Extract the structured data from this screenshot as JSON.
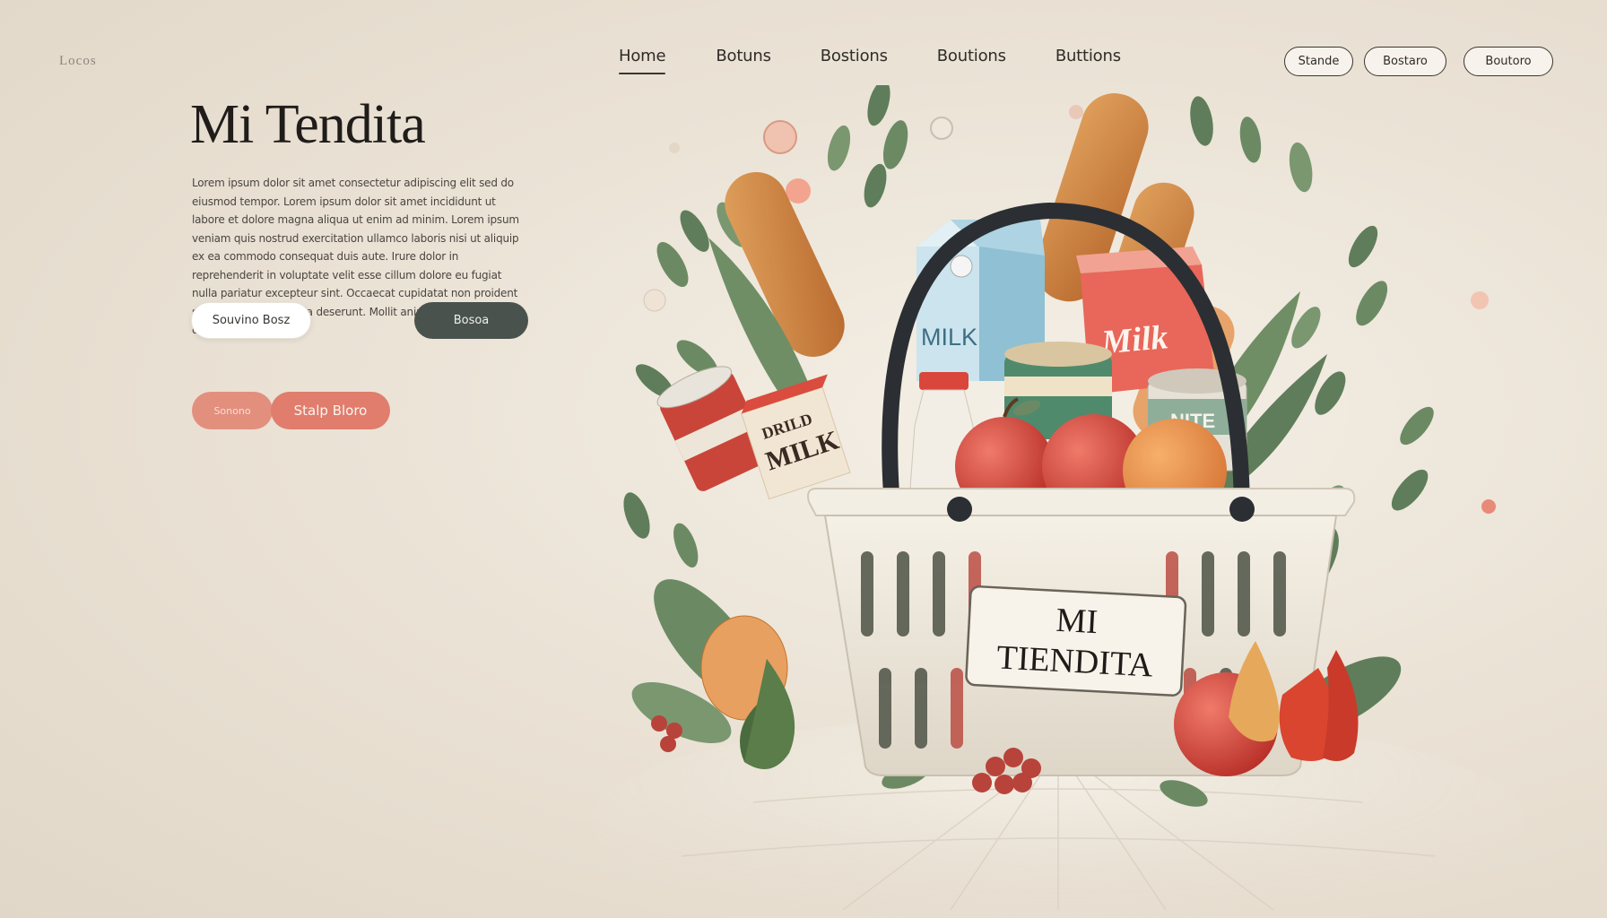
{
  "brand": {
    "logo_text": "Locos",
    "title": "Mi Tendita"
  },
  "nav": {
    "items": [
      {
        "label": "Home",
        "active": true
      },
      {
        "label": "Botuns"
      },
      {
        "label": "Bostions"
      },
      {
        "label": "Boutions"
      },
      {
        "label": "Buttions"
      }
    ]
  },
  "header_buttons": [
    "Stande",
    "Bostaro",
    "Boutoro"
  ],
  "hero": {
    "description": "Lorem ipsum dolor sit amet consectetur adipiscing elit sed do eiusmod tempor. Lorem ipsum dolor sit amet incididunt ut labore et dolore magna aliqua ut enim ad minim. Lorem ipsum veniam quis nostrud exercitation ullamco laboris nisi ut aliquip ex ea commodo consequat duis aute. Irure dolor in reprehenderit in voluptate velit esse cillum dolore eu fugiat nulla pariatur excepteur sint. Occaecat cupidatat non proident sunt in culpa qui officia deserunt. Mollit anim id est laborum et dolorum fuga.",
    "buttons": {
      "primary_white": "Souvino Bosz",
      "dark": "Bosoa",
      "coral_left": "Sonono",
      "coral_right": "Stalp Bloro"
    }
  },
  "illustration": {
    "basket_label_line1": "MI",
    "basket_label_line2": "TIENDITA",
    "carton_label": "MILK",
    "box_label": "Milk",
    "small_box_label_top": "DRILD",
    "small_box_label_bottom": "MILK",
    "can_label": "NITE"
  },
  "colors": {
    "background": "#ebe3d6",
    "accent_coral": "#e07d6c",
    "dark_button": "#4a524e",
    "leaf_green": "#5f7d5a"
  }
}
